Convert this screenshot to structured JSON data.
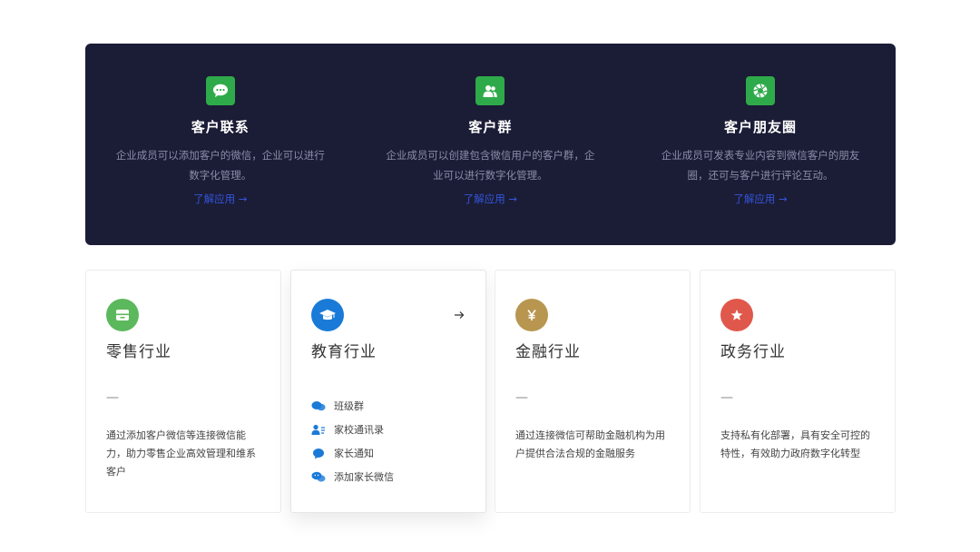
{
  "hero": {
    "items": [
      {
        "title": "客户联系",
        "desc": "企业成员可以添加客户的微信，企业可以进行数字化管理。",
        "link": "了解应用 →",
        "icon": "chat-bubble-icon"
      },
      {
        "title": "客户群",
        "desc": "企业成员可以创建包含微信用户的客户群，企业可以进行数字化管理。",
        "link": "了解应用 →",
        "icon": "group-icon"
      },
      {
        "title": "客户朋友圈",
        "desc": "企业成员可发表专业内容到微信客户的朋友圈，还可与客户进行评论互动。",
        "link": "了解应用 →",
        "icon": "moments-icon"
      }
    ]
  },
  "industries": [
    {
      "title": "零售行业",
      "dash": "—",
      "desc": "通过添加客户微信等连接微信能力，助力零售企业高效管理和维系客户",
      "icon": "store-icon",
      "color": "#5cb85c"
    },
    {
      "title": "教育行业",
      "dash": "—",
      "icon": "graduation-cap-icon",
      "color": "#1a7ad8",
      "features": [
        {
          "label": "班级群",
          "icon": "class-group-icon"
        },
        {
          "label": "家校通讯录",
          "icon": "contacts-icon"
        },
        {
          "label": "家长通知",
          "icon": "notice-icon"
        },
        {
          "label": "添加家长微信",
          "icon": "wechat-icon"
        }
      ]
    },
    {
      "title": "金融行业",
      "dash": "—",
      "desc": "通过连接微信可帮助金融机构为用户提供合法合规的金融服务",
      "icon": "yen-icon",
      "color": "#b8964f"
    },
    {
      "title": "政务行业",
      "dash": "—",
      "desc": "支持私有化部署，具有安全可控的特性，有效助力政府数字化转型",
      "icon": "star-icon",
      "color": "#e0574b"
    }
  ],
  "colors": {
    "hero_bg": "#1b1c36",
    "hero_icon": "#2faa4a",
    "link": "#3355d8"
  }
}
